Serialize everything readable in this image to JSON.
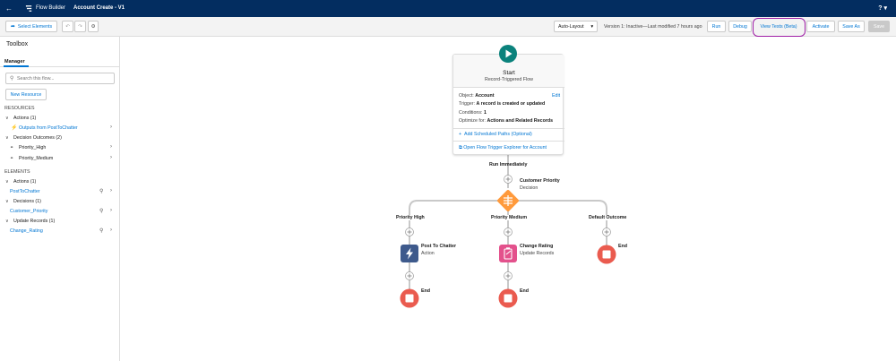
{
  "header": {
    "back_icon": "back-arrow-icon",
    "app_name": "Flow Builder",
    "flow_name": "Account Create - V1",
    "help_label": "?"
  },
  "toolbar": {
    "select_elements": "Select Elements",
    "layout_select": "Auto-Layout",
    "version_text": "Version 1: Inactive—Last modified 7 hours ago",
    "run": "Run",
    "debug": "Debug",
    "view_tests": "View Tests (Beta)",
    "activate": "Activate",
    "save_as": "Save As",
    "save": "Save"
  },
  "sidebar": {
    "title": "Toolbox",
    "tab": "Manager",
    "search_placeholder": "Search this flow...",
    "new_resource": "New Resource",
    "resources_heading": "RESOURCES",
    "resources": [
      {
        "label": "Actions (1)"
      },
      {
        "label": "Outputs from PostToChatter"
      },
      {
        "label": "Decision Outcomes (2)"
      },
      {
        "label": "Priority_High"
      },
      {
        "label": "Priority_Medium"
      }
    ],
    "elements_heading": "ELEMENTS",
    "elements": [
      {
        "label": "Actions (1)"
      },
      {
        "label": "PostToChatter"
      },
      {
        "label": "Decisions (1)"
      },
      {
        "label": "Customer_Priority"
      },
      {
        "label": "Update Records (1)"
      },
      {
        "label": "Change_Rating"
      }
    ]
  },
  "start": {
    "title": "Start",
    "subtitle": "Record-Triggered Flow",
    "object_label": "Object:",
    "object_value": "Account",
    "edit": "Edit",
    "trigger_label": "Trigger:",
    "trigger_value": "A record is created or updated",
    "conditions_label": "Conditions:",
    "conditions_value": "1",
    "optimize_label": "Optimize for:",
    "optimize_value": "Actions and Related Records",
    "add_scheduled": "Add Scheduled Paths (Optional)",
    "open_explorer": "Open Flow Trigger Explorer for Account"
  },
  "flow": {
    "run_immediately": "Run Immediately",
    "decision_name": "Customer Priority",
    "decision_type": "Decision",
    "branches": [
      "Priority High",
      "Priority Medium",
      "Default Outcome"
    ],
    "action_name": "Post To Chatter",
    "action_type": "Action",
    "update_name": "Change Rating",
    "update_type": "Update Records",
    "end_label": "End"
  },
  "colors": {
    "header_bg": "#032d60",
    "brand_blue": "#0176d3",
    "start_green": "#0b827c",
    "decision_orange": "#ff9a3c",
    "action_navy": "#3e5a8c",
    "update_pink": "#e3518c",
    "end_red": "#ea5b4f",
    "annotation_purple": "#9f1fa6"
  }
}
